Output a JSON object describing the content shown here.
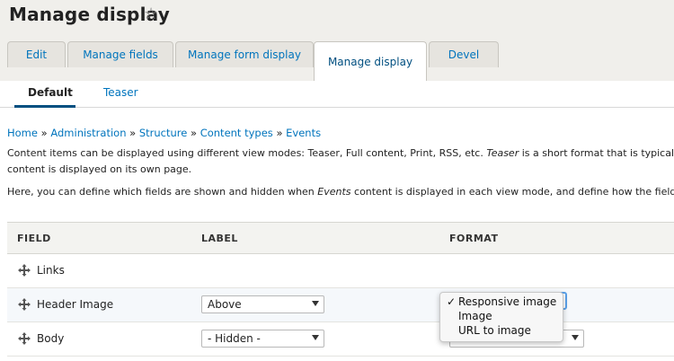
{
  "header": {
    "title": "Manage display",
    "star_icon": "star-icon"
  },
  "primary_tabs": [
    {
      "label": "Edit",
      "active": false
    },
    {
      "label": "Manage fields",
      "active": false
    },
    {
      "label": "Manage form display",
      "active": false
    },
    {
      "label": "Manage display",
      "active": true
    },
    {
      "label": "Devel",
      "active": false
    }
  ],
  "secondary_tabs": [
    {
      "label": "Default",
      "active": true
    },
    {
      "label": "Teaser",
      "active": false
    }
  ],
  "breadcrumb": [
    "Home",
    "Administration",
    "Structure",
    "Content types",
    "Events"
  ],
  "breadcrumb_sep": "»",
  "description": {
    "line1_a": "Content items can be displayed using different view modes: Teaser, Full content, Print, RSS, etc. ",
    "line1_em": "Teaser",
    "line1_b": " is a short format that is typically u",
    "line2": "content is displayed on its own page.",
    "line3_a": "Here, you can define which fields are shown and hidden when ",
    "line3_em": "Events",
    "line3_b": " content is displayed in each view mode, and define how the fields are"
  },
  "table": {
    "columns": [
      "FIELD",
      "LABEL",
      "FORMAT"
    ],
    "rows": [
      {
        "field": "Links",
        "label": "",
        "format": ""
      },
      {
        "field": "Header Image",
        "label": "Above",
        "format": "Responsive image"
      },
      {
        "field": "Body",
        "label": "- Hidden -",
        "format": ""
      }
    ]
  },
  "format_dropdown": {
    "options": [
      "Responsive image",
      "Image",
      "URL to image"
    ],
    "checked": "Responsive image",
    "check_mark": "✓"
  },
  "colors": {
    "link": "#0074bd",
    "accent": "#004f80",
    "focus": "#5aa0e8"
  }
}
